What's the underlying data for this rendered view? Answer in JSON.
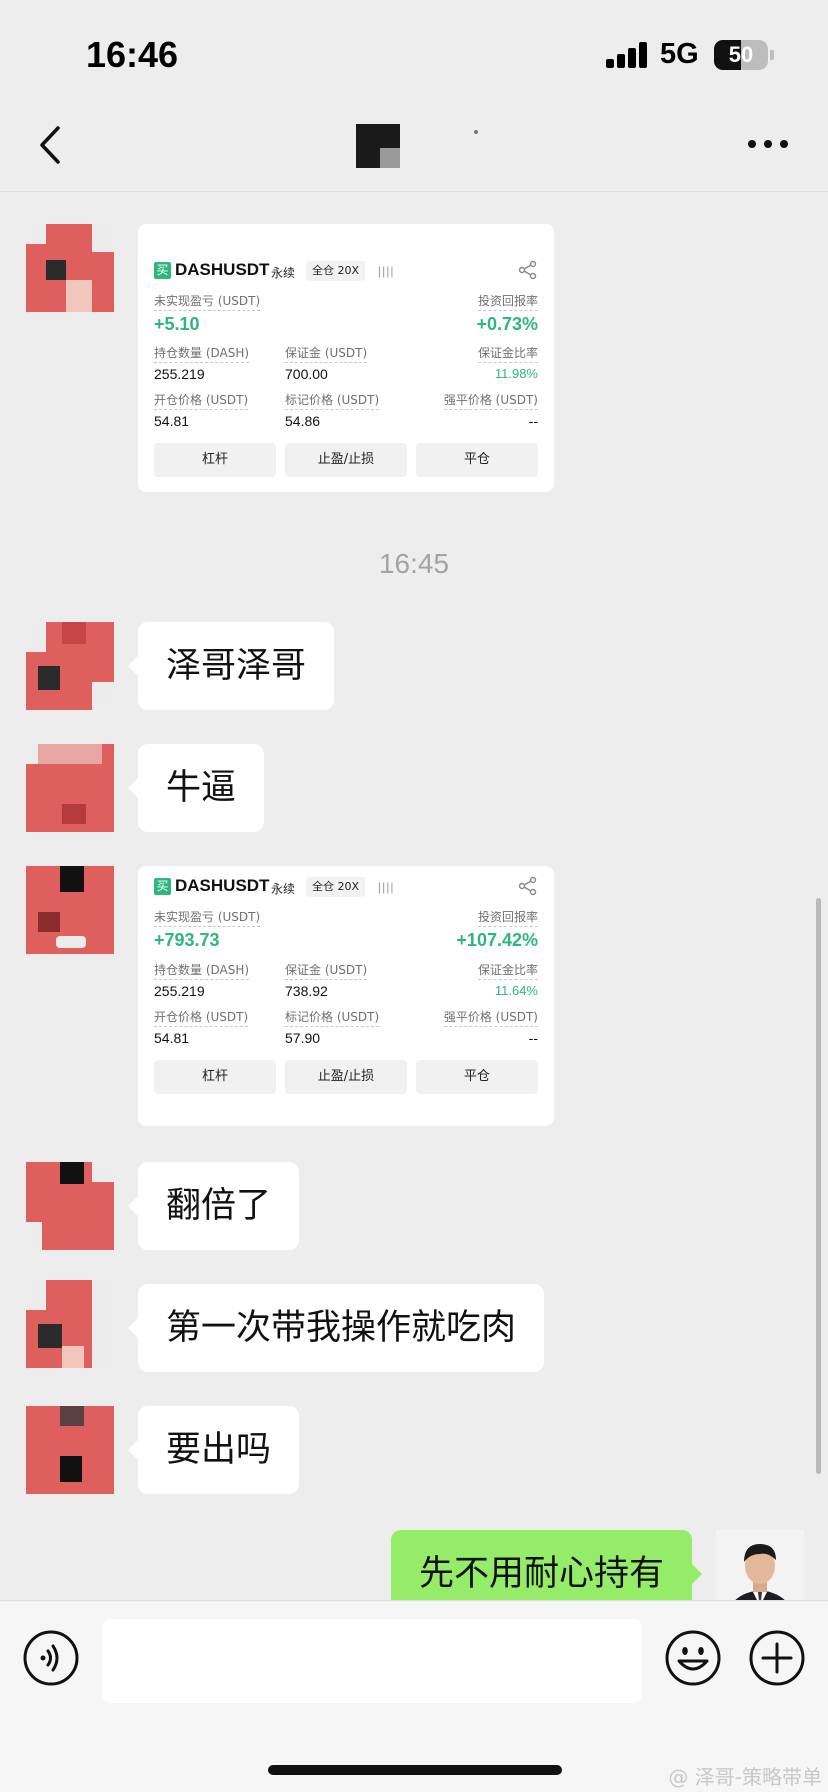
{
  "status_bar": {
    "time": "16:46",
    "network": "5G",
    "battery_level": "50",
    "battery_fraction": 0.5
  },
  "nav": {
    "back_icon": "chevron-left-icon",
    "more_icon": "more-dots-icon"
  },
  "time_separator": "16:45",
  "cards": [
    {
      "tag": "买",
      "symbol": "DASHUSDT",
      "contract": "永续",
      "margin_mode": "全仓 20X",
      "bars": "||||",
      "pnl_label": "未实现盈亏 (USDT)",
      "pnl_value": "+5.10",
      "roe_label": "投资回报率",
      "roe_value": "+0.73%",
      "qty_label": "持仓数量 (DASH)",
      "qty_value": "255.219",
      "margin_label": "保证金 (USDT)",
      "margin_value": "700.00",
      "margin_ratio_label": "保证金比率",
      "margin_ratio_value": "11.98%",
      "entry_label": "开仓价格 (USDT)",
      "entry_value": "54.81",
      "mark_label": "标记价格 (USDT)",
      "mark_value": "54.86",
      "liq_label": "强平价格 (USDT)",
      "liq_value": "--",
      "buttons": [
        "杠杆",
        "止盈/止损",
        "平仓"
      ]
    },
    {
      "tag": "买",
      "symbol": "DASHUSDT",
      "contract": "永续",
      "margin_mode": "全仓 20X",
      "bars": "||||",
      "pnl_label": "未实现盈亏 (USDT)",
      "pnl_value": "+793.73",
      "roe_label": "投资回报率",
      "roe_value": "+107.42%",
      "qty_label": "持仓数量 (DASH)",
      "qty_value": "255.219",
      "margin_label": "保证金 (USDT)",
      "margin_value": "738.92",
      "margin_ratio_label": "保证金比率",
      "margin_ratio_value": "11.64%",
      "entry_label": "开仓价格 (USDT)",
      "entry_value": "54.81",
      "mark_label": "标记价格 (USDT)",
      "mark_value": "57.90",
      "liq_label": "强平价格 (USDT)",
      "liq_value": "--",
      "buttons": [
        "杠杆",
        "止盈/止损",
        "平仓"
      ]
    }
  ],
  "messages": [
    "泽哥泽哥",
    "牛逼",
    "翻倍了",
    "第一次带我操作就吃肉",
    "要出吗",
    "先不用耐心持有"
  ],
  "colors": {
    "profit_green": "#2eb67d",
    "out_bubble": "#95ec69",
    "avatar_red": "#df5e5e"
  },
  "input_bar": {
    "voice_icon": "voice-icon",
    "emoji_icon": "emoji-icon",
    "plus_icon": "plus-icon"
  },
  "watermark": "@ 泽哥-策略带单"
}
